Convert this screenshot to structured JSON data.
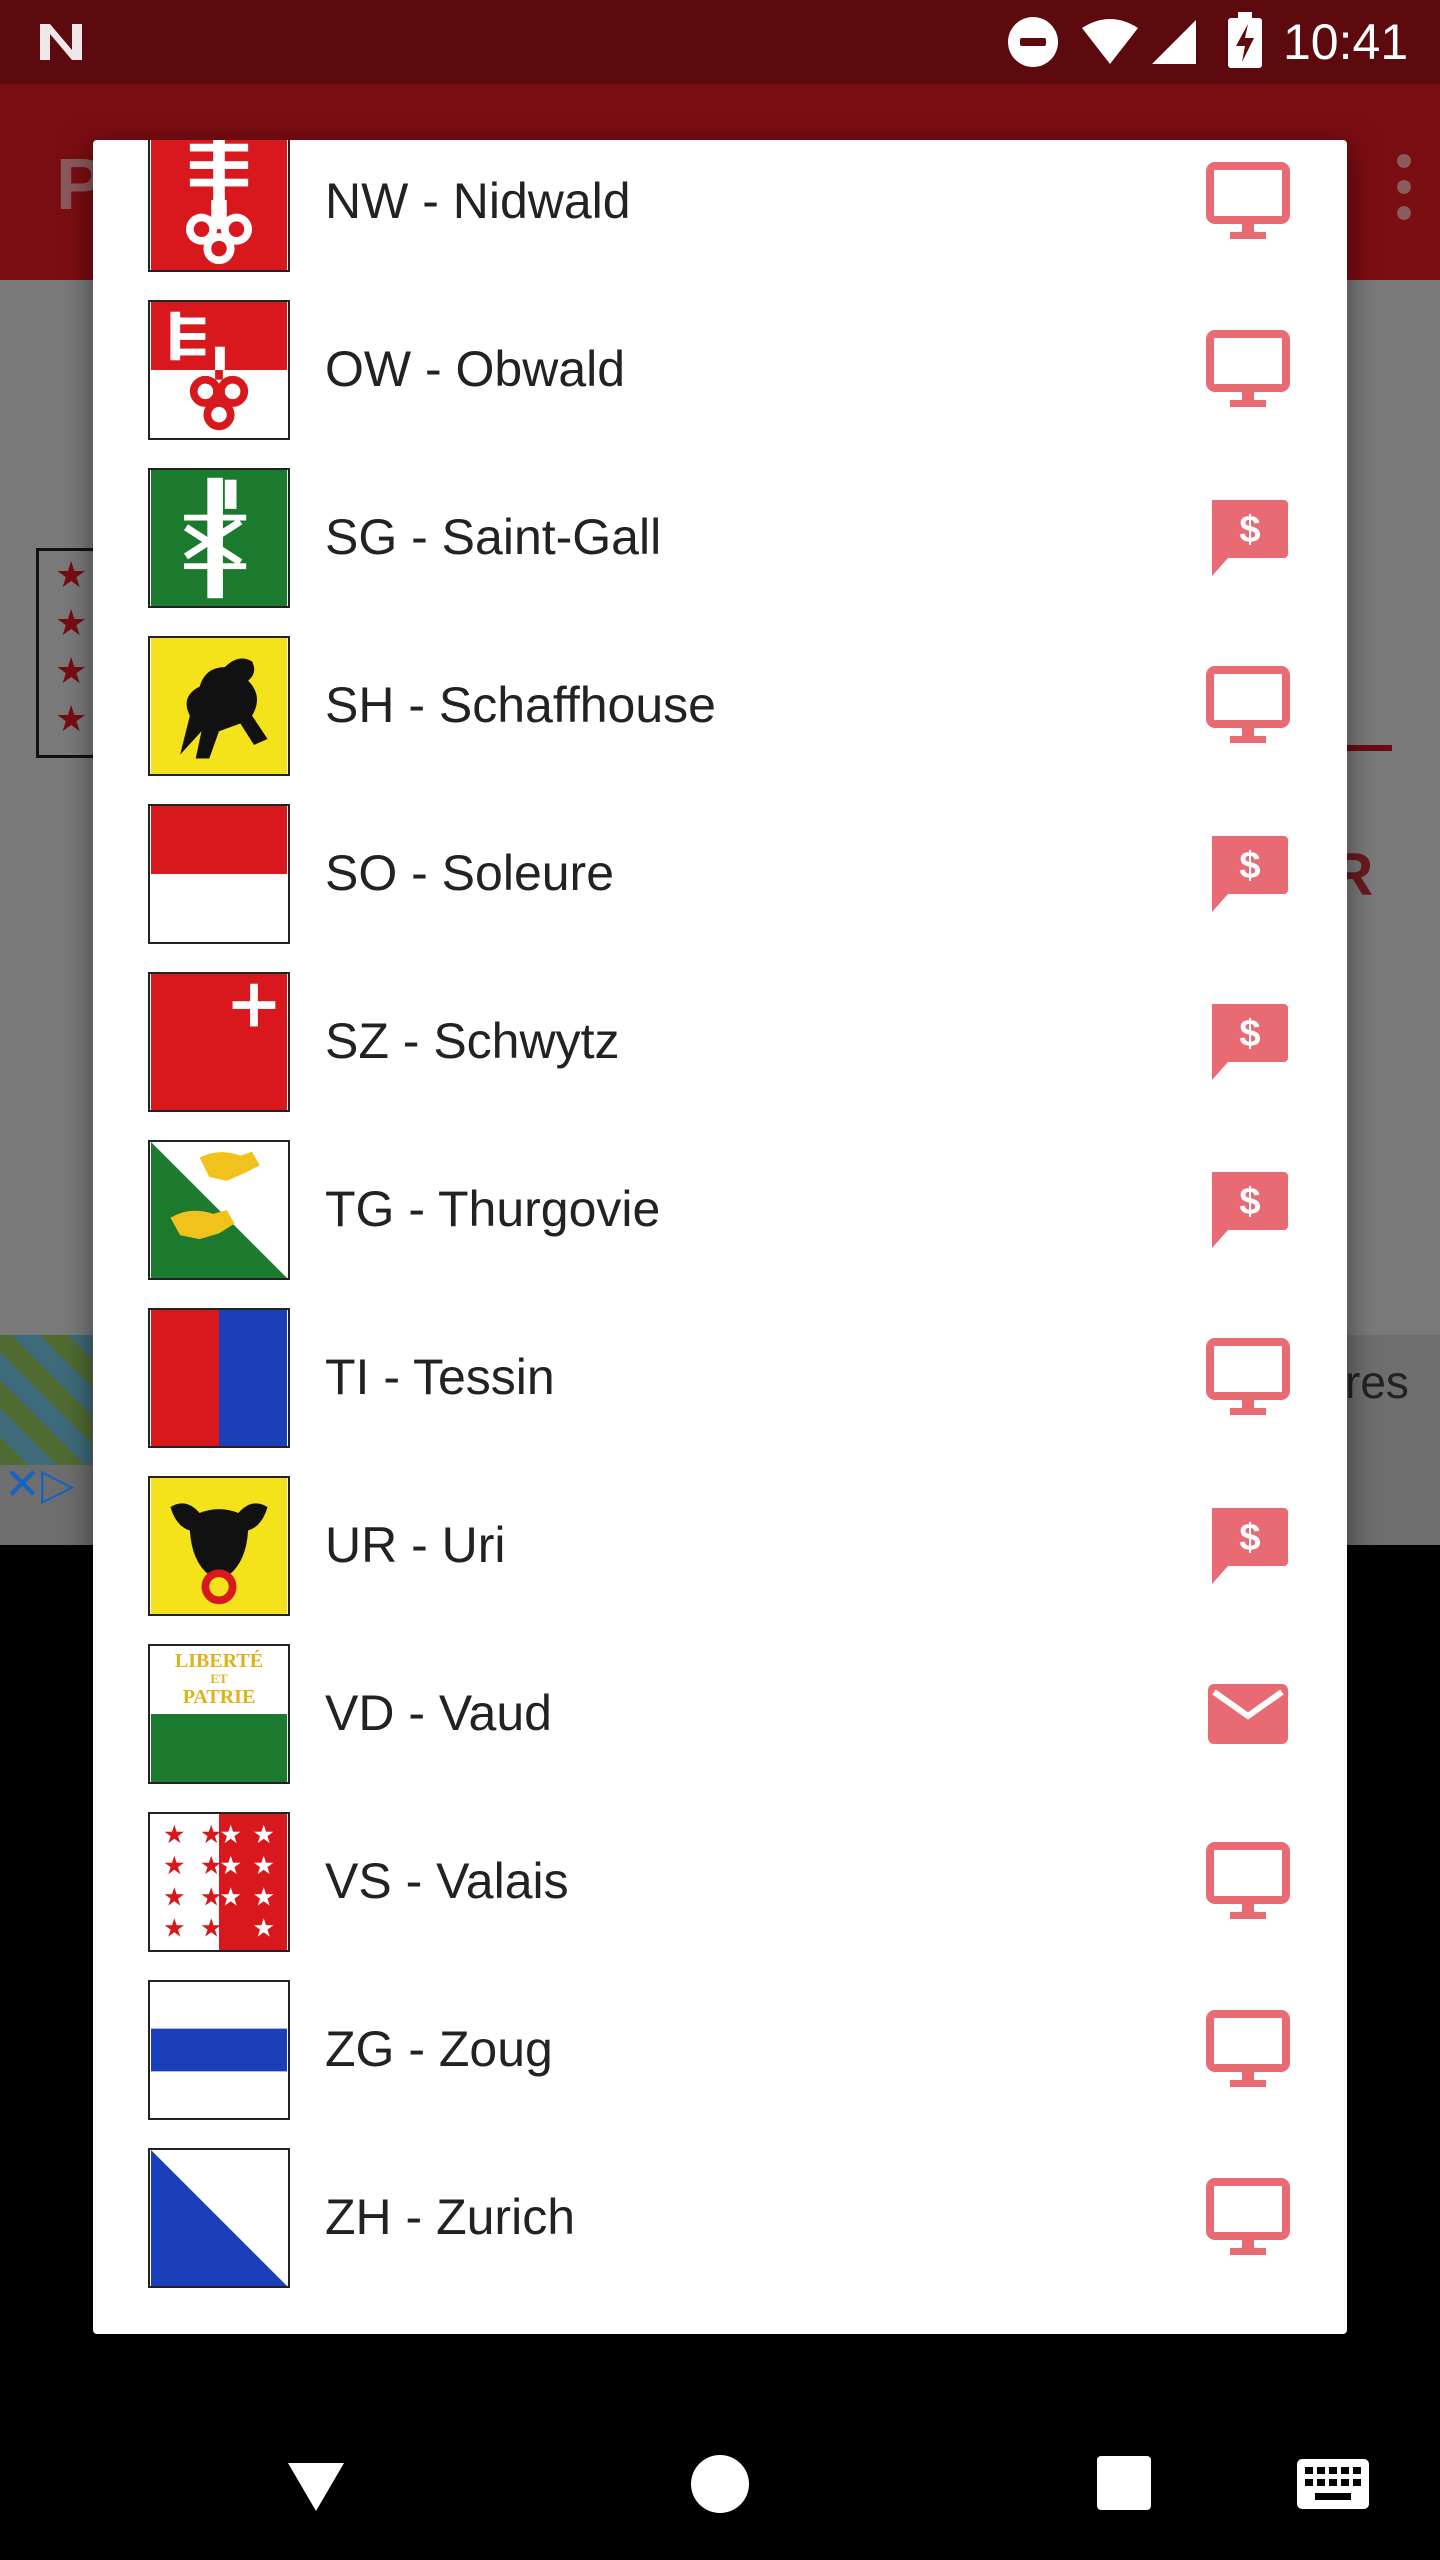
{
  "status_bar": {
    "time": "10:41",
    "icons": [
      "n-logo-icon",
      "do-not-disturb-icon",
      "wifi-icon",
      "signal-icon",
      "battery-charging-icon"
    ]
  },
  "background_app": {
    "title_fragment": "P",
    "letter_fragment": "R",
    "ad_text_fragment": "res",
    "stars": [
      "★",
      "★",
      "★",
      "★"
    ],
    "ad_close": "✕▷"
  },
  "colors": {
    "accent": "#e86b74",
    "status_bar": "#5c0a0e",
    "app_bar": "#7a0d12",
    "scrim": "#7a7a7a"
  },
  "dialog": {
    "items": [
      {
        "label": "NW - Nidwald",
        "flag": "nidwald-flag-icon",
        "action": "monitor-icon"
      },
      {
        "label": "OW - Obwald",
        "flag": "obwald-flag-icon",
        "action": "monitor-icon"
      },
      {
        "label": "SG - Saint-Gall",
        "flag": "saint-gall-flag-icon",
        "action": "paid-message-icon"
      },
      {
        "label": "SH - Schaffhouse",
        "flag": "schaffhouse-flag-icon",
        "action": "monitor-icon"
      },
      {
        "label": "SO - Soleure",
        "flag": "soleure-flag-icon",
        "action": "paid-message-icon"
      },
      {
        "label": "SZ - Schwytz",
        "flag": "schwytz-flag-icon",
        "action": "paid-message-icon"
      },
      {
        "label": "TG - Thurgovie",
        "flag": "thurgovie-flag-icon",
        "action": "paid-message-icon"
      },
      {
        "label": "TI - Tessin",
        "flag": "tessin-flag-icon",
        "action": "monitor-icon"
      },
      {
        "label": "UR - Uri",
        "flag": "uri-flag-icon",
        "action": "paid-message-icon"
      },
      {
        "label": "VD - Vaud",
        "flag": "vaud-flag-icon",
        "flag_text": [
          "LIBERTÉ",
          "ET",
          "PATRIE"
        ],
        "action": "mail-icon"
      },
      {
        "label": "VS - Valais",
        "flag": "valais-flag-icon",
        "action": "monitor-icon"
      },
      {
        "label": "ZG - Zoug",
        "flag": "zoug-flag-icon",
        "action": "monitor-icon"
      },
      {
        "label": "ZH - Zurich",
        "flag": "zurich-flag-icon",
        "action": "monitor-icon"
      }
    ]
  },
  "nav_bar": {
    "icons": [
      "back-icon",
      "home-icon",
      "recents-icon",
      "keyboard-icon"
    ]
  }
}
